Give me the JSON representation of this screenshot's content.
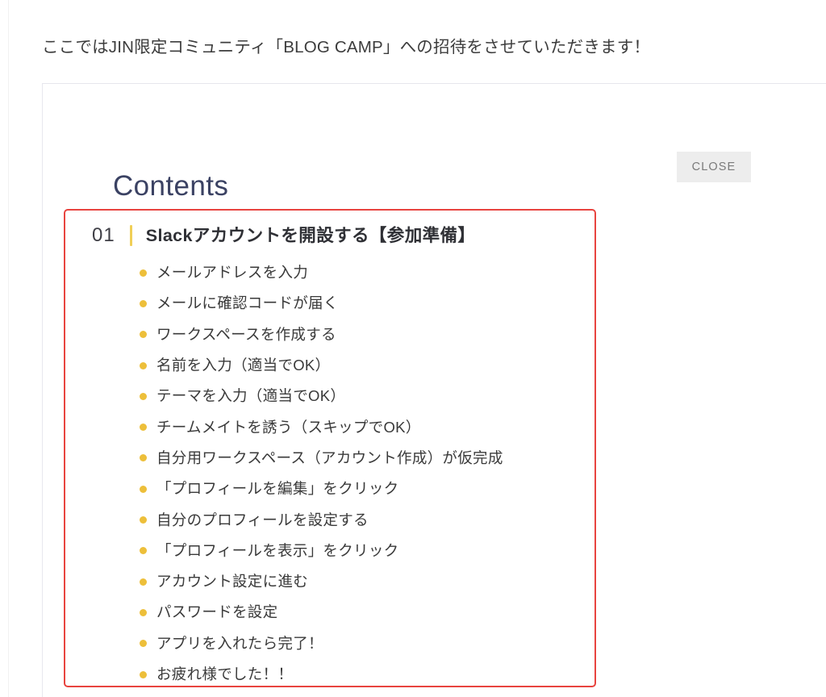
{
  "page": {
    "intro_text": "ここではJIN限定コミュニティ「BLOG CAMP」への招待をさせていただきます！"
  },
  "card": {
    "heading": "Contents",
    "close_label": "CLOSE"
  },
  "colors": {
    "heading": "#3b4263",
    "section_border": "#e8443f",
    "bullet": "#edbf3a",
    "divider": "#f0cf57",
    "close_bg": "#ededed",
    "close_text": "#7a7a7a"
  },
  "section": {
    "number": "01",
    "title": "Slackアカウントを開設する【参加準備】",
    "items": [
      {
        "label": "メールアドレスを入力"
      },
      {
        "label": "メールに確認コードが届く"
      },
      {
        "label": "ワークスペースを作成する"
      },
      {
        "label": "名前を入力（適当でOK）"
      },
      {
        "label": "テーマを入力（適当でOK）"
      },
      {
        "label": "チームメイトを誘う（スキップでOK）"
      },
      {
        "label": "自分用ワークスペース（アカウント作成）が仮完成"
      },
      {
        "label": "「プロフィールを編集」をクリック"
      },
      {
        "label": "自分のプロフィールを設定する"
      },
      {
        "label": "「プロフィールを表示」をクリック"
      },
      {
        "label": "アカウント設定に進む"
      },
      {
        "label": "パスワードを設定"
      },
      {
        "label": "アプリを入れたら完了！"
      },
      {
        "label": "お疲れ様でした！！"
      }
    ]
  }
}
